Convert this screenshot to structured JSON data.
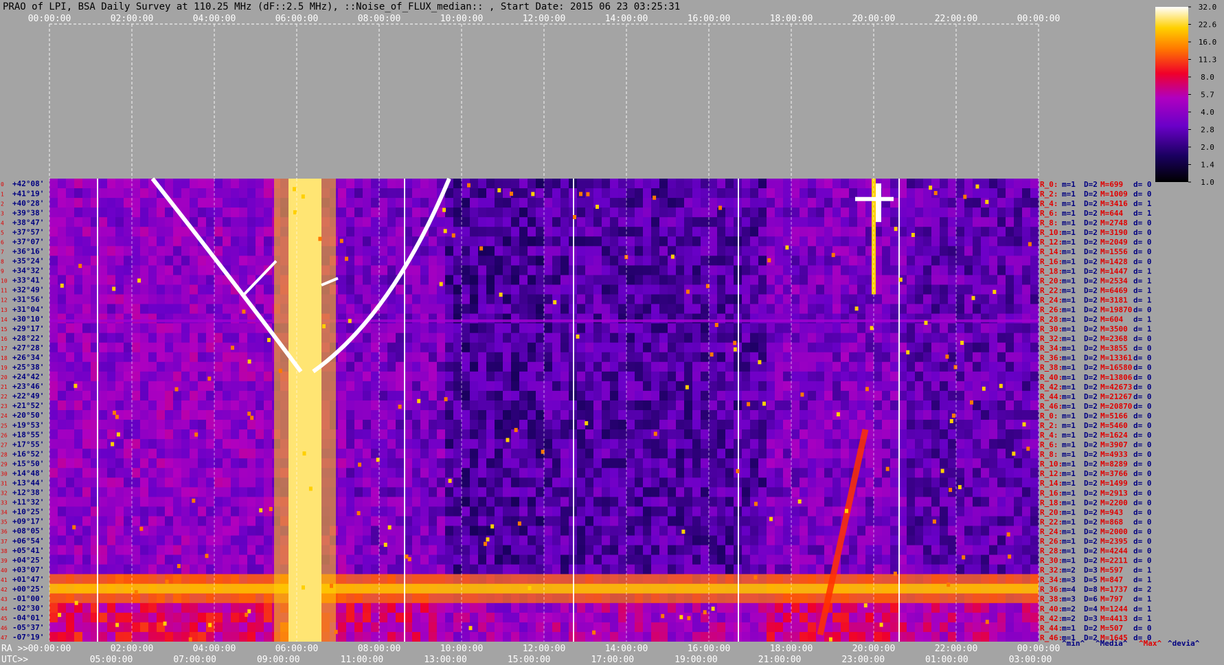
{
  "title": "PRAO of LPI, BSA Daily Survey at 110.25 MHz (dF::2.5 MHz), ::Noise_of_FLUX_median:: , Start Date: 2015 06 23 03:25:31",
  "colors": {
    "background": "#a4a4a4",
    "red_text": "#e00000",
    "navy_text": "#000080",
    "grid": "#ffffff"
  },
  "chart_data": {
    "type": "heatmap",
    "top_axis": {
      "ticks": [
        "00:00:00",
        "02:00:00",
        "04:00:00",
        "06:00:00",
        "08:00:00",
        "10:00:00",
        "12:00:00",
        "14:00:00",
        "16:00:00",
        "18:00:00",
        "20:00:00",
        "22:00:00",
        "00:00:00"
      ]
    },
    "bottom_ra": {
      "prefix": "RA >>",
      "ticks": [
        "00:00:00",
        "02:00:00",
        "04:00:00",
        "06:00:00",
        "08:00:00",
        "10:00:00",
        "12:00:00",
        "14:00:00",
        "16:00:00",
        "18:00:00",
        "20:00:00",
        "22:00:00",
        "00:00:00"
      ]
    },
    "bottom_utc": {
      "prefix": "UTC>>",
      "ticks": [
        "05:00:00",
        "07:00:00",
        "09:00:00",
        "11:00:00",
        "13:00:00",
        "15:00:00",
        "17:00:00",
        "19:00:00",
        "21:00:00",
        "23:00:00",
        "01:00:00",
        "03:00:00"
      ]
    },
    "colorbar": {
      "ticks": [
        "32.0",
        "22.6",
        "16.0",
        "11.3",
        "8.0",
        "5.7",
        "4.0",
        "2.8",
        "2.0",
        "1.4",
        "1.0"
      ],
      "range": [
        1.0,
        32.0
      ]
    },
    "declinations": [
      "+42°08'",
      "+41°19'",
      "+40°28'",
      "+39°38'",
      "+38°47'",
      "+37°57'",
      "+37°07'",
      "+36°16'",
      "+35°24'",
      "+34°32'",
      "+33°41'",
      "+32°49'",
      "+31°56'",
      "+31°04'",
      "+30°10'",
      "+29°17'",
      "+28°22'",
      "+27°28'",
      "+26°34'",
      "+25°38'",
      "+24°42'",
      "+23°46'",
      "+22°49'",
      "+21°52'",
      "+20°50'",
      "+19°53'",
      "+18°55'",
      "+17°55'",
      "+16°52'",
      "+15°50'",
      "+14°48'",
      "+13°44'",
      "+12°38'",
      "+11°32'",
      "+10°25'",
      "+09°17'",
      "+08°05'",
      "+06°54'",
      "+05°41'",
      "+04°25'",
      "+03°07'",
      "+01°47'",
      "+00°25'",
      "-01°00'",
      "-02°30'",
      "-04°01'",
      "-05°37'",
      "-07°19'"
    ],
    "channels": [
      {
        "r": "R_0:",
        "m": "m=1",
        "d": "D=2",
        "M": "M=699",
        "dev": "d= 0"
      },
      {
        "r": "R_2:",
        "m": "m=1",
        "d": "D=2",
        "M": "M=1009",
        "dev": "d= 0"
      },
      {
        "r": "R_4:",
        "m": "m=1",
        "d": "D=2",
        "M": "M=3416",
        "dev": "d= 1"
      },
      {
        "r": "R_6:",
        "m": "m=1",
        "d": "D=2",
        "M": "M=644",
        "dev": "d= 1"
      },
      {
        "r": "R_8:",
        "m": "m=1",
        "d": "D=2",
        "M": "M=2748",
        "dev": "d= 0"
      },
      {
        "r": "R_10:",
        "m": "m=1",
        "d": "D=2",
        "M": "M=3190",
        "dev": "d= 0"
      },
      {
        "r": "R_12:",
        "m": "m=1",
        "d": "D=2",
        "M": "M=2049",
        "dev": "d= 0"
      },
      {
        "r": "R_14:",
        "m": "m=1",
        "d": "D=2",
        "M": "M=1556",
        "dev": "d= 0"
      },
      {
        "r": "R_16:",
        "m": "m=1",
        "d": "D=2",
        "M": "M=1428",
        "dev": "d= 0"
      },
      {
        "r": "R_18:",
        "m": "m=1",
        "d": "D=2",
        "M": "M=1447",
        "dev": "d= 1"
      },
      {
        "r": "R_20:",
        "m": "m=1",
        "d": "D=2",
        "M": "M=2534",
        "dev": "d= 1"
      },
      {
        "r": "R_22:",
        "m": "m=1",
        "d": "D=2",
        "M": "M=6469",
        "dev": "d= 1"
      },
      {
        "r": "R_24:",
        "m": "m=1",
        "d": "D=2",
        "M": "M=3181",
        "dev": "d= 1"
      },
      {
        "r": "R_26:",
        "m": "m=1",
        "d": "D=2",
        "M": "M=19870",
        "dev": "d= 0"
      },
      {
        "r": "R_28:",
        "m": "m=1",
        "d": "D=2",
        "M": "M=604",
        "dev": "d= 1"
      },
      {
        "r": "R_30:",
        "m": "m=1",
        "d": "D=2",
        "M": "M=3500",
        "dev": "d= 1"
      },
      {
        "r": "R_32:",
        "m": "m=1",
        "d": "D=2",
        "M": "M=2368",
        "dev": "d= 0"
      },
      {
        "r": "R_34:",
        "m": "m=1",
        "d": "D=2",
        "M": "M=3855",
        "dev": "d= 0"
      },
      {
        "r": "R_36:",
        "m": "m=1",
        "d": "D=2",
        "M": "M=13361",
        "dev": "d= 0"
      },
      {
        "r": "R_38:",
        "m": "m=1",
        "d": "D=2",
        "M": "M=16580",
        "dev": "d= 0"
      },
      {
        "r": "R_40:",
        "m": "m=1",
        "d": "D=2",
        "M": "M=13806",
        "dev": "d= 0"
      },
      {
        "r": "R_42:",
        "m": "m=1",
        "d": "D=2",
        "M": "M=42673",
        "dev": "d= 0"
      },
      {
        "r": "R_44:",
        "m": "m=1",
        "d": "D=2",
        "M": "M=21267",
        "dev": "d= 0"
      },
      {
        "r": "R_46:",
        "m": "m=1",
        "d": "D=2",
        "M": "M=20870",
        "dev": "d= 0"
      },
      {
        "r": "R_0:",
        "m": "m=1",
        "d": "D=2",
        "M": "M=5166",
        "dev": "d= 0"
      },
      {
        "r": "R_2:",
        "m": "m=1",
        "d": "D=2",
        "M": "M=5460",
        "dev": "d= 0"
      },
      {
        "r": "R_4:",
        "m": "m=1",
        "d": "D=2",
        "M": "M=1624",
        "dev": "d= 0"
      },
      {
        "r": "R_6:",
        "m": "m=1",
        "d": "D=2",
        "M": "M=3907",
        "dev": "d= 0"
      },
      {
        "r": "R_8:",
        "m": "m=1",
        "d": "D=2",
        "M": "M=4933",
        "dev": "d= 0"
      },
      {
        "r": "R_10:",
        "m": "m=1",
        "d": "D=2",
        "M": "M=8289",
        "dev": "d= 0"
      },
      {
        "r": "R_12:",
        "m": "m=1",
        "d": "D=2",
        "M": "M=3766",
        "dev": "d= 0"
      },
      {
        "r": "R_14:",
        "m": "m=1",
        "d": "D=2",
        "M": "M=1499",
        "dev": "d= 0"
      },
      {
        "r": "R_16:",
        "m": "m=1",
        "d": "D=2",
        "M": "M=2913",
        "dev": "d= 0"
      },
      {
        "r": "R_18:",
        "m": "m=1",
        "d": "D=2",
        "M": "M=2200",
        "dev": "d= 0"
      },
      {
        "r": "R_20:",
        "m": "m=1",
        "d": "D=2",
        "M": "M=943",
        "dev": "d= 0"
      },
      {
        "r": "R_22:",
        "m": "m=1",
        "d": "D=2",
        "M": "M=868",
        "dev": "d= 0"
      },
      {
        "r": "R_24:",
        "m": "m=1",
        "d": "D=2",
        "M": "M=2000",
        "dev": "d= 0"
      },
      {
        "r": "R_26:",
        "m": "m=1",
        "d": "D=2",
        "M": "M=2395",
        "dev": "d= 0"
      },
      {
        "r": "R_28:",
        "m": "m=1",
        "d": "D=2",
        "M": "M=4244",
        "dev": "d= 0"
      },
      {
        "r": "R_30:",
        "m": "m=1",
        "d": "D=2",
        "M": "M=2211",
        "dev": "d= 0"
      },
      {
        "r": "R_32:",
        "m": "m=2",
        "d": "D=3",
        "M": "M=597",
        "dev": "d= 1"
      },
      {
        "r": "R_34:",
        "m": "m=3",
        "d": "D=5",
        "M": "M=847",
        "dev": "d= 1"
      },
      {
        "r": "R_36:",
        "m": "m=4",
        "d": "D=8",
        "M": "M=1737",
        "dev": "d= 2"
      },
      {
        "r": "R_38:",
        "m": "m=3",
        "d": "D=6",
        "M": "M=797",
        "dev": "d= 1"
      },
      {
        "r": "R_40:",
        "m": "m=2",
        "d": "D=4",
        "M": "M=1244",
        "dev": "d= 1"
      },
      {
        "r": "R_42:",
        "m": "m=2",
        "d": "D=3",
        "M": "M=4413",
        "dev": "d= 1"
      },
      {
        "r": "R_44:",
        "m": "m=1",
        "d": "D=2",
        "M": "M=507",
        "dev": "d= 0"
      },
      {
        "r": "R_46:",
        "m": "m=1",
        "d": "D=2",
        "M": "M=1645",
        "dev": "d= 0"
      }
    ],
    "legend_keys": [
      {
        "label": "^min^",
        "color": "#000080"
      },
      {
        "label": "^Media^",
        "color": "#000080"
      },
      {
        "label": "^Max^",
        "color": "#e00000"
      },
      {
        "label": "^devia^",
        "color": "#000080"
      }
    ]
  }
}
